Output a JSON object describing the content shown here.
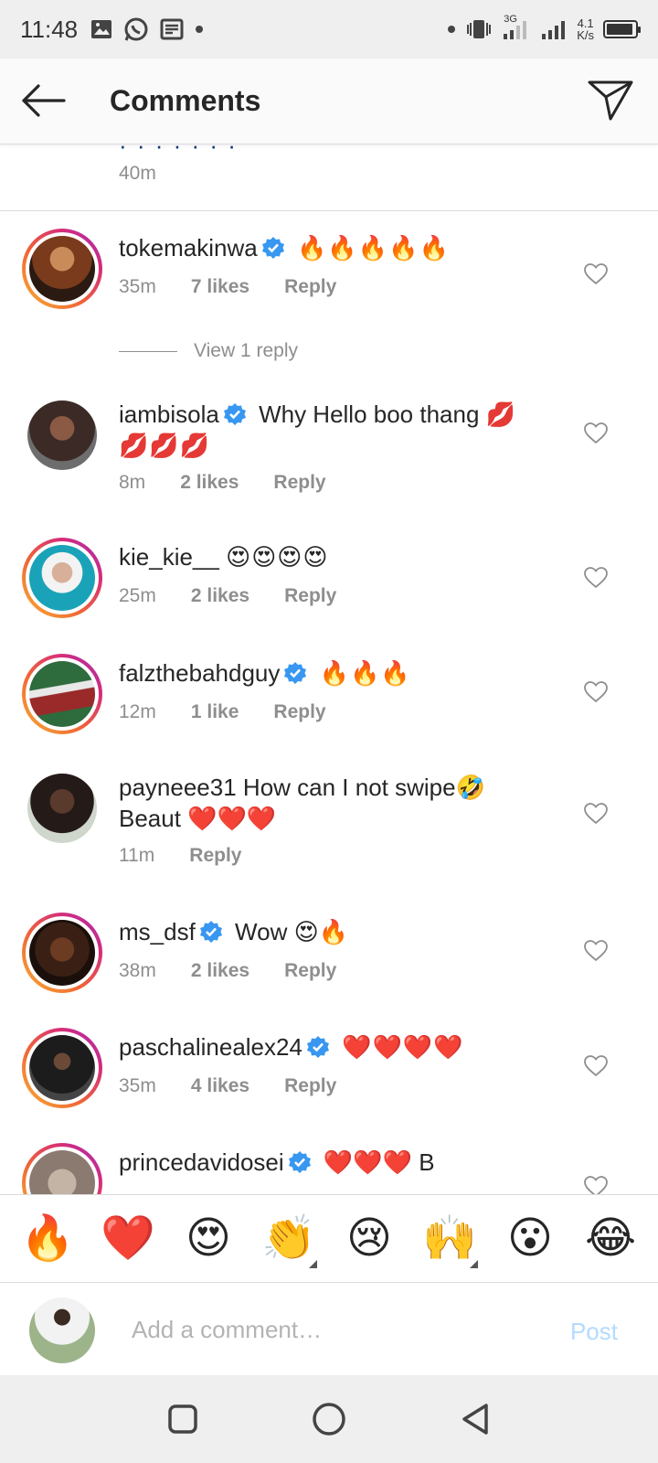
{
  "status_bar": {
    "time": "11:48",
    "network": "3G",
    "speed_value": "4.1",
    "speed_unit": "K/s"
  },
  "header": {
    "title": "Comments",
    "back_icon": "arrow-left-icon",
    "send_icon": "paper-plane-icon"
  },
  "previous_comment": {
    "time": "40m"
  },
  "comments": [
    {
      "username": "tokemakinwa",
      "verified": true,
      "text": "🔥🔥🔥🔥🔥",
      "text2": "",
      "time": "35m",
      "likes": "7 likes",
      "reply": "Reply",
      "view_replies": "View 1 reply",
      "avatar_color": "#7a3b1c"
    },
    {
      "username": "iambisola",
      "verified": true,
      "text": "Why Hello boo thang 💋",
      "text2": "💋💋💋",
      "time": "8m",
      "likes": "2 likes",
      "reply": "Reply",
      "avatar_color": "#3b2a26"
    },
    {
      "username": "kie_kie__",
      "verified": false,
      "text": "😍😍😍😍",
      "text2": "",
      "time": "25m",
      "likes": "2 likes",
      "reply": "Reply",
      "avatar_color": "#1aa3b8"
    },
    {
      "username": "falzthebahdguy",
      "verified": true,
      "text": "🔥🔥🔥",
      "text2": "",
      "time": "12m",
      "likes": "1 like",
      "reply": "Reply",
      "avatar_color": "#2e6b3d"
    },
    {
      "username": "payneee31",
      "verified": false,
      "text": "How can I not swipe🤣",
      "text2": "Beaut ❤️❤️❤️",
      "time": "11m",
      "likes": "",
      "reply": "Reply",
      "avatar_color": "#241a18"
    },
    {
      "username": "ms_dsf",
      "verified": true,
      "text": "Wow 😍🔥",
      "text2": "",
      "time": "38m",
      "likes": "2 likes",
      "reply": "Reply",
      "avatar_color": "#3a2014"
    },
    {
      "username": "paschalinealex24",
      "verified": true,
      "text": "❤️❤️❤️❤️",
      "text2": "",
      "time": "35m",
      "likes": "4 likes",
      "reply": "Reply",
      "avatar_color": "#1c1c1c"
    },
    {
      "username": "princedavidosei",
      "verified": true,
      "text": "❤️❤️❤️ B",
      "text2": "",
      "time": "",
      "likes": "",
      "reply": "",
      "avatar_color": "#8a7a70"
    }
  ],
  "emoji_bar": [
    "🔥",
    "❤️",
    "😍",
    "👏",
    "😢",
    "🙌",
    "😮",
    "😂"
  ],
  "input": {
    "placeholder": "Add a comment…",
    "post_label": "Post"
  },
  "colors": {
    "accent_blue": "#3897f0",
    "post_disabled": "#b3dbff",
    "meta_gray": "#8e8e8e",
    "text_dark": "#262626"
  }
}
